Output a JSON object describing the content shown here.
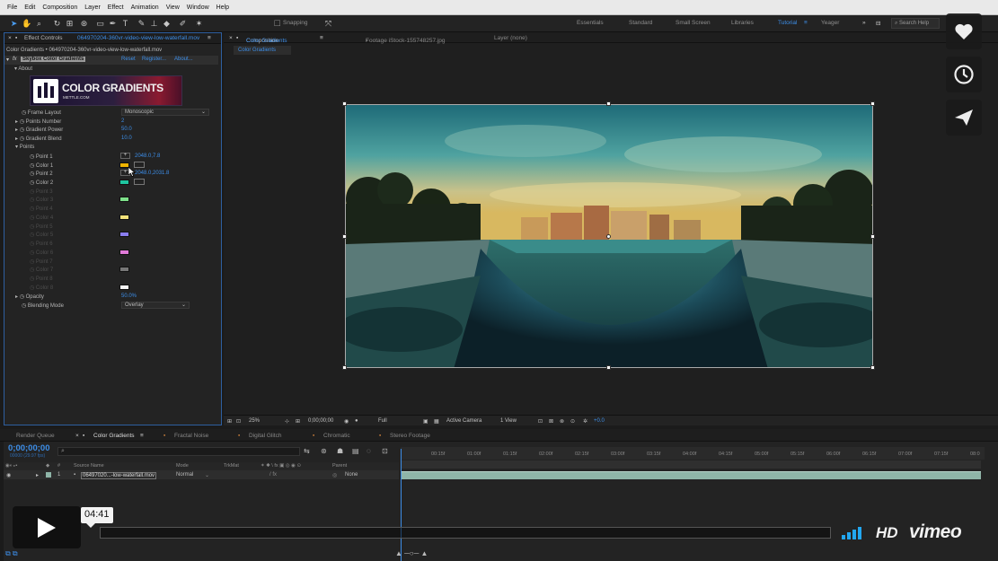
{
  "menu": [
    "File",
    "Edit",
    "Composition",
    "Layer",
    "Effect",
    "Animation",
    "View",
    "Window",
    "Help"
  ],
  "toolbar": {
    "snapping": "Snapping",
    "workspaces": [
      "Essentials",
      "Standard",
      "Small Screen",
      "Libraries",
      "Tutorial",
      "Yeager"
    ],
    "active_workspace": "Tutorial",
    "search_placeholder": "Search Help"
  },
  "effect_controls": {
    "tab_label": "Effect Controls",
    "tab_file": "064970204-360vr-video-view-low-waterfall.mov",
    "path": "Color Gradients • 064970204-360vr-video-view-low-waterfall.mov",
    "effect_name": "Skybox Color Gradients",
    "reset": "Reset",
    "register": "Register...",
    "about_link": "About...",
    "about_group": "About",
    "banner_title": "COLOR GRADIENTS",
    "banner_sub": "METTLE.COM",
    "props": {
      "frame_layout": "Frame Layout",
      "frame_layout_value": "Monoscopic",
      "points_number": "Points Number",
      "points_number_value": "2",
      "gradient_power": "Gradient Power",
      "gradient_power_value": "50.0",
      "gradient_blend": "Gradient Blend",
      "gradient_blend_value": "10.0",
      "points_group": "Points",
      "point1": "Point 1",
      "point1_value": "2048.0,7.8",
      "color1": "Color 1",
      "point2": "Point 2",
      "point2_value": "2048.0,2031.8",
      "color2": "Color 2",
      "opacity": "Opacity",
      "opacity_value": "50.0%",
      "blending_mode": "Blending Mode",
      "blending_mode_value": "Overlay"
    },
    "dim_rows": [
      "Point 3",
      "Color 3",
      "Point 4",
      "Color 4",
      "Point 5",
      "Color 5",
      "Point 6",
      "Color 6",
      "Point 7",
      "Color 7",
      "Point 8",
      "Color 8"
    ],
    "colors": {
      "color1": "#f0b400",
      "color2": "#1ec6a0",
      "color3": "#7ee08a",
      "color4": "#f2e27a",
      "color5": "#8a7ef0",
      "color6": "#e07ad8",
      "color7": "#777777",
      "color8": "#f5f5f5"
    }
  },
  "composition": {
    "tab_label": "Composition",
    "tab_name": "Color Gradients",
    "footage_tab": "Footage iStock-155748257.jpg",
    "layer_tab": "Layer (none)",
    "viewer_tab": "Color Gradients",
    "footer": {
      "zoom": "25%",
      "timecode": "0;00;00;00",
      "resolution": "Full",
      "camera": "Active Camera",
      "views": "1 View",
      "exposure": "+0.0"
    }
  },
  "timeline": {
    "tabs": [
      "Render Queue",
      "Color Gradients",
      "Fractal Noise",
      "Digital Glitch",
      "Chromatic",
      "Stereo Footage"
    ],
    "active_tab": "Color Gradients",
    "timecode": "0;00;00;00",
    "timecode_sub": "00000 (29.97 fps)",
    "ruler_labels": [
      "00:15f",
      "01:00f",
      "01:15f",
      "02:00f",
      "02:15f",
      "03:00f",
      "03:15f",
      "04:00f",
      "04:15f",
      "05:00f",
      "05:15f",
      "06:00f",
      "06:15f",
      "07:00f",
      "07:15f",
      "08:0"
    ],
    "columns": {
      "num": "#",
      "source": "Source Name",
      "mode": "Mode",
      "trkmat": "TrkMat",
      "parent": "Parent"
    },
    "layer": {
      "num": "1",
      "name": "06497020...-low-waterfall.mov",
      "mode": "Normal",
      "parent": "None"
    }
  },
  "player": {
    "time_bubble": "04:41",
    "progress": 0,
    "hd": "HD",
    "brand": "vimeo",
    "accent": "#22a7f0"
  },
  "side_buttons": [
    "heart-icon",
    "clock-icon",
    "send-icon"
  ]
}
